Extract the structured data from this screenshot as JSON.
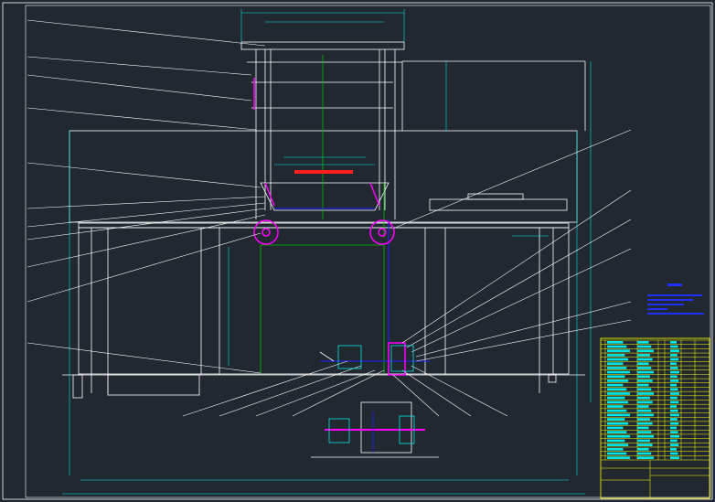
{
  "drawing": {
    "background": "#212830",
    "colors": {
      "frame": "#ffffff",
      "outline": "#ffffff",
      "dimension": "#00e5e5",
      "leader": "#ffffff",
      "centerline": "#00c000",
      "axis": "#2020ff",
      "highlight": "#ff00ff",
      "hatch_red": "#ff2020",
      "title_block_grid": "#ffff00",
      "title_block_text": "#00e5e5",
      "notes": "#2030ff"
    },
    "views": [
      "front-elevation",
      "drive-detail"
    ],
    "parts_list_rows": 28
  }
}
